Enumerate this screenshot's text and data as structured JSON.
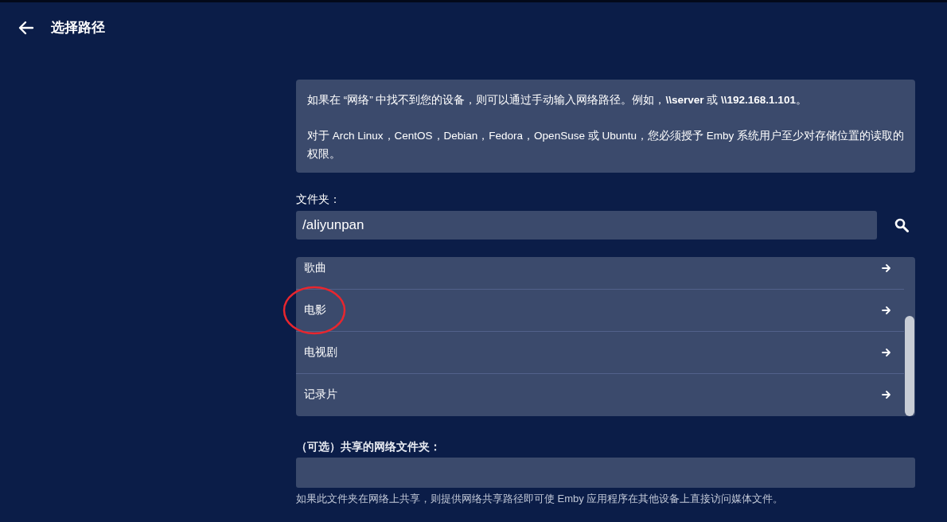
{
  "header": {
    "title": "选择路径"
  },
  "info": [
    "如果在 “网络” 中找不到您的设备，则可以通过手动输入网络路径。例如，**\\\\server** 或 **\\\\192.168.1.101**。",
    "对于 Arch Linux，CentOS，Debian，Fedora，OpenSuse 或 Ubuntu，您必须授予 Emby 系统用户至少对存储位置的读取的权限。"
  ],
  "folder": {
    "label": "文件夹：",
    "value": "/aliyunpan"
  },
  "folders": [
    {
      "name": "歌曲",
      "circled": false
    },
    {
      "name": "电影",
      "circled": true
    },
    {
      "name": "电视剧",
      "circled": false
    },
    {
      "name": "记录片",
      "circled": false
    }
  ],
  "network_share": {
    "label": "（可选）共享的网络文件夹：",
    "help": "如果此文件夹在网络上共享，则提供网络共享路径即可使 Emby 应用程序在其他设备上直接访问媒体文件。"
  }
}
